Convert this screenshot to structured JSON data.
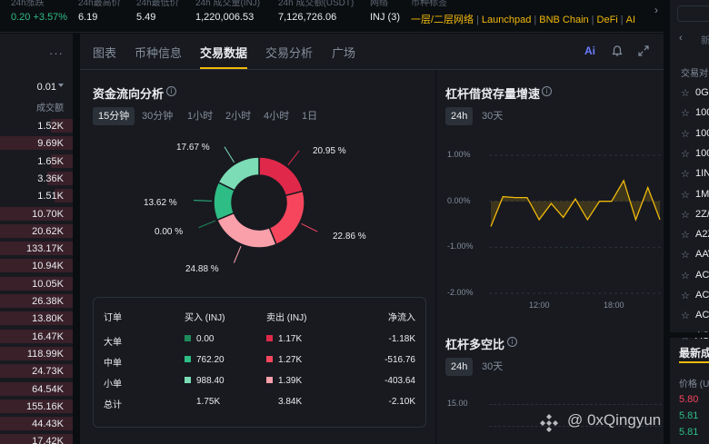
{
  "ticker": {
    "items": [
      {
        "label": "24h涨跌",
        "value": "0.20 +3.57%"
      },
      {
        "label": "24h最高价",
        "value": "6.19"
      },
      {
        "label": "24h最低价",
        "value": "5.49"
      },
      {
        "label": "24h 成交量(INJ)",
        "value": "1,220,006.53"
      },
      {
        "label": "24h 成交额(USDT)",
        "value": "7,126,726.06"
      },
      {
        "label": "网络",
        "value": "INJ (3)"
      }
    ],
    "tags_label": "币种标签",
    "tags": [
      "一层/二层网络",
      "Launchpad",
      "BNB Chain",
      "DeFi",
      "AI"
    ]
  },
  "book": {
    "step": "0.01",
    "column_header": "成交额",
    "rows": [
      "1.52K",
      "9.69K",
      "1.65K",
      "3.36K",
      "1.51K",
      "10.70K",
      "20.62K",
      "133.17K",
      "10.94K",
      "10.05K",
      "26.38K",
      "13.80K",
      "16.47K",
      "118.99K",
      "24.73K",
      "64.54K",
      "155.16K",
      "44.43K",
      "17.42K"
    ],
    "fill": [
      0.3,
      1.0,
      0.3,
      0.35,
      0.25,
      1.0,
      1.0,
      1.0,
      1.0,
      1.0,
      1.0,
      1.0,
      1.0,
      1.0,
      1.0,
      1.0,
      1.0,
      1.0,
      1.0
    ]
  },
  "tabs": [
    "图表",
    "币种信息",
    "交易数据",
    "交易分析",
    "广场"
  ],
  "toolbar": {
    "ai_label": "Ai"
  },
  "fund_flow": {
    "title": "资金流向分析",
    "periods": [
      "15分钟",
      "30分钟",
      "1小时",
      "2小时",
      "4小时",
      "1日"
    ],
    "active_period": "15分钟",
    "slices": [
      {
        "label": "20.95 %",
        "value": 20.95,
        "color": "#e0294a"
      },
      {
        "label": "22.86 %",
        "value": 22.86,
        "color": "#f6465d"
      },
      {
        "label": "24.88 %",
        "value": 24.88,
        "color": "#f9a0aa"
      },
      {
        "label": "0.00 %",
        "value": 0.0,
        "color": "#1f8a5b"
      },
      {
        "label": "13.62 %",
        "value": 13.62,
        "color": "#2ebd85"
      },
      {
        "label": "17.67 %",
        "value": 17.67,
        "color": "#7bdcb5"
      }
    ],
    "table": {
      "headers": [
        "订单",
        "买入 (INJ)",
        "卖出 (INJ)",
        "净流入"
      ],
      "rows": [
        {
          "name": "大单",
          "buy": "0.00",
          "sell": "1.17K",
          "net": "-1.18K",
          "buy_color": "#1f8a5b",
          "sell_color": "#e0294a"
        },
        {
          "name": "中单",
          "buy": "762.20",
          "sell": "1.27K",
          "net": "-516.76",
          "buy_color": "#2ebd85",
          "sell_color": "#f6465d"
        },
        {
          "name": "小单",
          "buy": "988.40",
          "sell": "1.39K",
          "net": "-403.64",
          "buy_color": "#7bdcb5",
          "sell_color": "#f9a0aa"
        },
        {
          "name": "总计",
          "buy": "1.75K",
          "sell": "3.84K",
          "net": "-2.10K"
        }
      ]
    }
  },
  "margin_growth": {
    "title": "杠杆借贷存量增速",
    "periods": [
      "24h",
      "30天"
    ],
    "active_period": "24h",
    "y_ticks": [
      "1.00%",
      "0.00%",
      "-1.00%",
      "-2.00%"
    ],
    "x_ticks": [
      "12:00",
      "18:00"
    ]
  },
  "long_short": {
    "title": "杠杆多空比",
    "periods": [
      "24h",
      "30天"
    ],
    "active_period": "24h",
    "y_ticks": [
      "15.00"
    ]
  },
  "chart_data": [
    {
      "type": "pie",
      "categories": [
        "20.95 %",
        "22.86 %",
        "24.88 %",
        "0.00 %",
        "13.62 %",
        "17.67 %"
      ],
      "values": [
        20.95,
        22.86,
        24.88,
        0.0,
        13.62,
        17.67
      ],
      "title": "资金流向分析"
    },
    {
      "type": "area",
      "title": "杠杆借贷存量增速",
      "ylim": [
        -2.0,
        1.0
      ],
      "x_ticks": [
        "12:00",
        "18:00"
      ],
      "values": [
        -0.55,
        0.1,
        0.08,
        0.08,
        -0.4,
        -0.05,
        -0.35,
        0.05,
        -0.4,
        0.0,
        0.0,
        0.45,
        -0.4,
        0.3,
        -0.4
      ]
    }
  ],
  "right_pane": {
    "top_char": "新",
    "header": "交易对",
    "items": [
      "0G",
      "100",
      "100",
      "100",
      "1IN",
      "1M",
      "2Z/",
      "A2Z",
      "AAV",
      "AC",
      "AC",
      "AC",
      "AC"
    ],
    "latest_title": "最新成",
    "price_label": "价格 (U",
    "prices": [
      "5.80",
      "5.81",
      "5.81"
    ]
  },
  "watermark": "@ 0xQingyun"
}
